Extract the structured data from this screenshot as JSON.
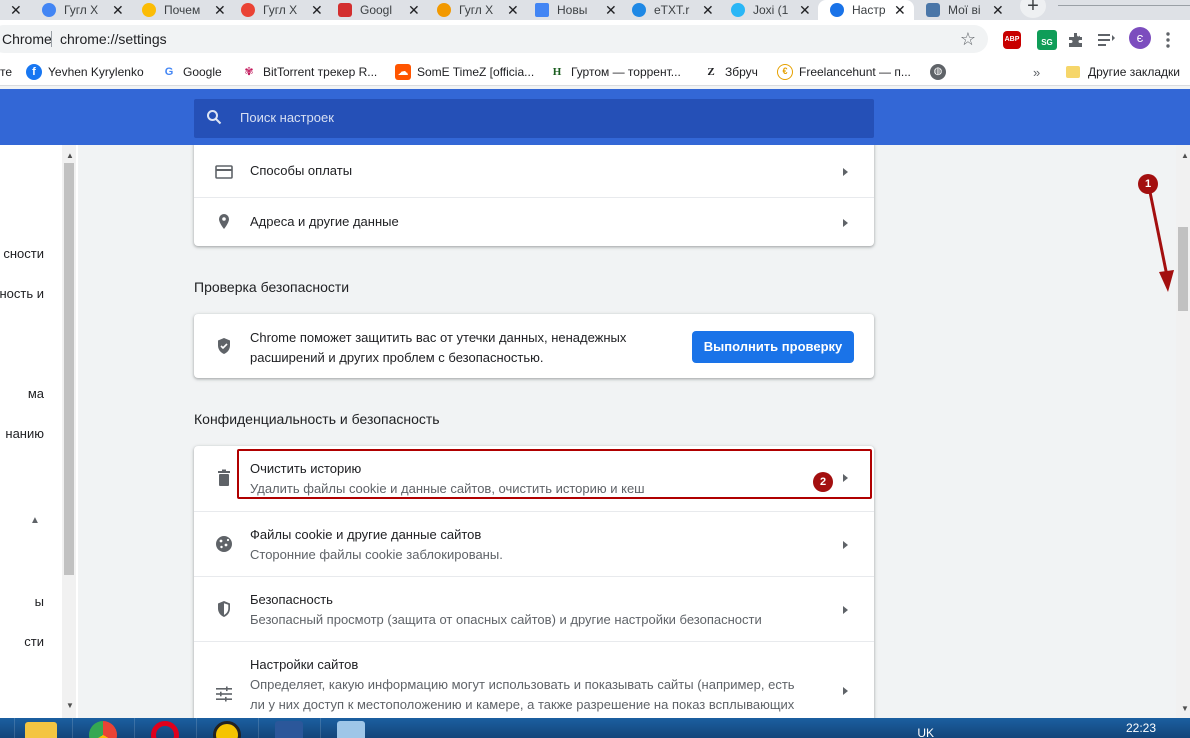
{
  "tabs": [
    {
      "title": "Гугл Х",
      "favicon_color": "#4285f4"
    },
    {
      "title": "Почем",
      "favicon_color": "#fbbc05"
    },
    {
      "title": "Гугл Х",
      "favicon_color": "#ea4335"
    },
    {
      "title": "Googl",
      "favicon_color": "#d32f2f"
    },
    {
      "title": "Гугл Х",
      "favicon_color": "#f29900"
    },
    {
      "title": "Новы",
      "favicon_color": "#4285f4"
    },
    {
      "title": "eTXT.r",
      "favicon_color": "#1e88e5"
    },
    {
      "title": "Joxi (1",
      "favicon_color": "#29b6f6"
    },
    {
      "title": "Настр",
      "favicon_color": "#1a73e8",
      "active": true
    },
    {
      "title": "Мої ві",
      "favicon_color": "#4a76a8"
    }
  ],
  "new_tab_label": "+",
  "omnibox": {
    "site_label": "Chrome",
    "url": "chrome://settings"
  },
  "extensions": {
    "abp": "ABP",
    "sg": "SG",
    "profile": "є"
  },
  "bookmarks": [
    {
      "label": "те",
      "icon": ""
    },
    {
      "label": "Yevhen Kyrylenko",
      "icon": "facebook-icon"
    },
    {
      "label": "Google",
      "icon": "google-icon"
    },
    {
      "label": "BitTorrent трекер R...",
      "icon": "bittorrent-icon"
    },
    {
      "label": "SomE TimeZ [officia...",
      "icon": "soundcloud-icon"
    },
    {
      "label": "Гуртом — торрент...",
      "icon": "hurtom-icon"
    },
    {
      "label": "Збруч",
      "icon": "zbruch-icon"
    },
    {
      "label": "Freelancehunt — п...",
      "icon": "freelancehunt-icon"
    },
    {
      "label": "",
      "icon": "globe-icon"
    }
  ],
  "bookmarks_more": "»",
  "other_bookmarks": "Другие закладки",
  "search": {
    "placeholder": "Поиск настроек"
  },
  "left_menu": [
    {
      "label": "сности"
    },
    {
      "label": "ность и"
    },
    {
      "label": "ма"
    },
    {
      "label": "нанию"
    },
    {
      "label": "ы"
    },
    {
      "label": "сти"
    }
  ],
  "autofill_card": {
    "rows": [
      {
        "title": "Способы оплаты",
        "icon": "credit-card-icon"
      },
      {
        "title": "Адреса и другие данные",
        "icon": "location-pin-icon"
      }
    ]
  },
  "safety_check": {
    "section_title": "Проверка безопасности",
    "description_line1": "Chrome поможет защитить вас от утечки данных, ненадежных",
    "description_line2": "расширений и других проблем с безопасностью.",
    "button_label": "Выполнить проверку"
  },
  "privacy": {
    "section_title": "Конфиденциальность и безопасность",
    "rows": [
      {
        "title": "Очистить историю",
        "subtitle": "Удалить файлы cookie и данные сайтов, очистить историю и кеш",
        "icon": "trash-icon"
      },
      {
        "title": "Файлы cookie и другие данные сайтов",
        "subtitle": "Сторонние файлы cookie заблокированы.",
        "icon": "cookie-icon"
      },
      {
        "title": "Безопасность",
        "subtitle": "Безопасный просмотр (защита от опасных сайтов) и другие настройки безопасности",
        "icon": "shield-icon"
      },
      {
        "title": "Настройки сайтов",
        "subtitle1": "Определяет, какую информацию могут использовать и показывать сайты (например, есть",
        "subtitle2": "ли у них доступ к местоположению и камере, а также разрешение на показ всплывающих",
        "icon": "sliders-icon"
      }
    ]
  },
  "annotations": {
    "marker1": "1",
    "marker2": "2"
  },
  "taskbar": {
    "language": "UK",
    "time": "22:23"
  }
}
